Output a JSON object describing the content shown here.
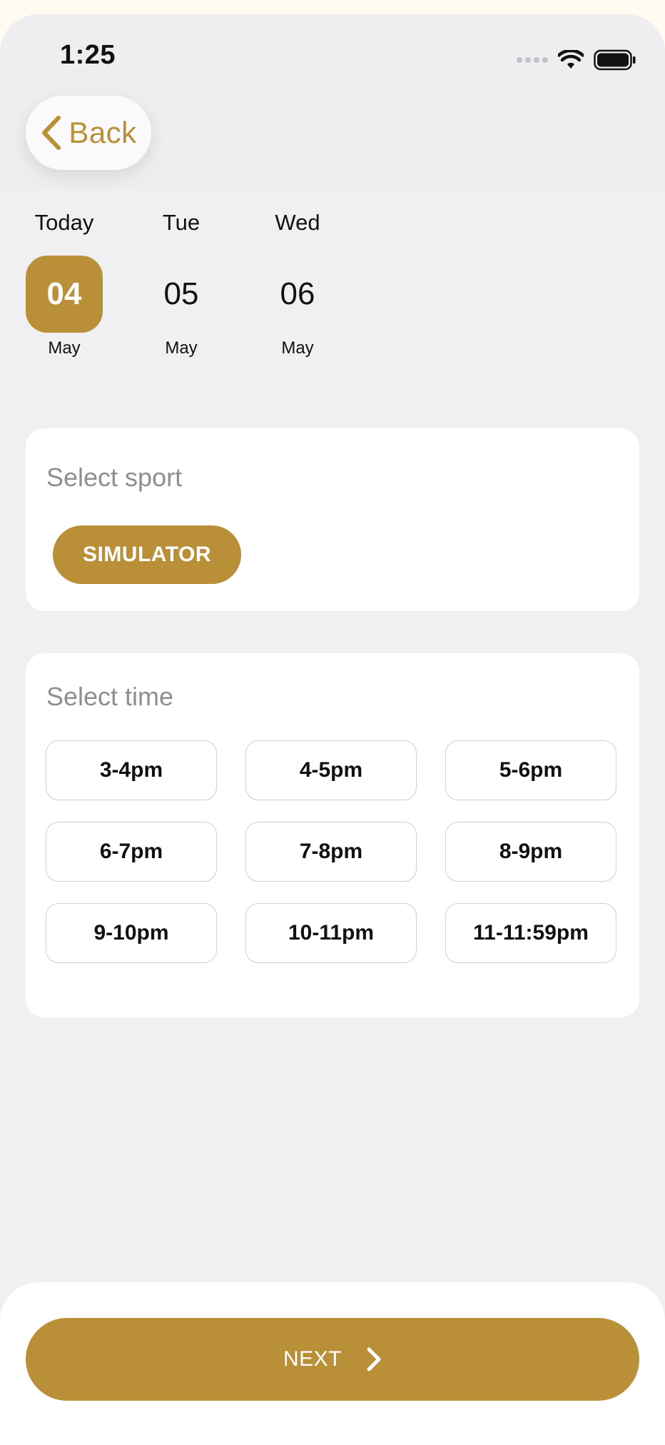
{
  "status_bar": {
    "time": "1:25"
  },
  "header": {
    "back_label": "Back"
  },
  "dates": [
    {
      "weekday": "Today",
      "day": "04",
      "month": "May",
      "selected": true
    },
    {
      "weekday": "Tue",
      "day": "05",
      "month": "May",
      "selected": false
    },
    {
      "weekday": "Wed",
      "day": "06",
      "month": "May",
      "selected": false
    }
  ],
  "sport_section": {
    "title": "Select sport",
    "options": [
      "SIMULATOR"
    ],
    "selected": "SIMULATOR"
  },
  "time_section": {
    "title": "Select time",
    "slots": [
      "3-4pm",
      "4-5pm",
      "5-6pm",
      "6-7pm",
      "7-8pm",
      "8-9pm",
      "9-10pm",
      "10-11pm",
      "11-11:59pm"
    ]
  },
  "footer": {
    "next_label": "NEXT"
  },
  "colors": {
    "accent": "#B99038",
    "background": "#F0F0F3",
    "card": "#FFFFFF",
    "muted_text": "#8E8E93"
  },
  "icons": {
    "back": "chevron-left-icon",
    "next": "chevron-right-icon",
    "wifi": "wifi-icon",
    "battery": "battery-icon",
    "signal": "signal-icon"
  }
}
